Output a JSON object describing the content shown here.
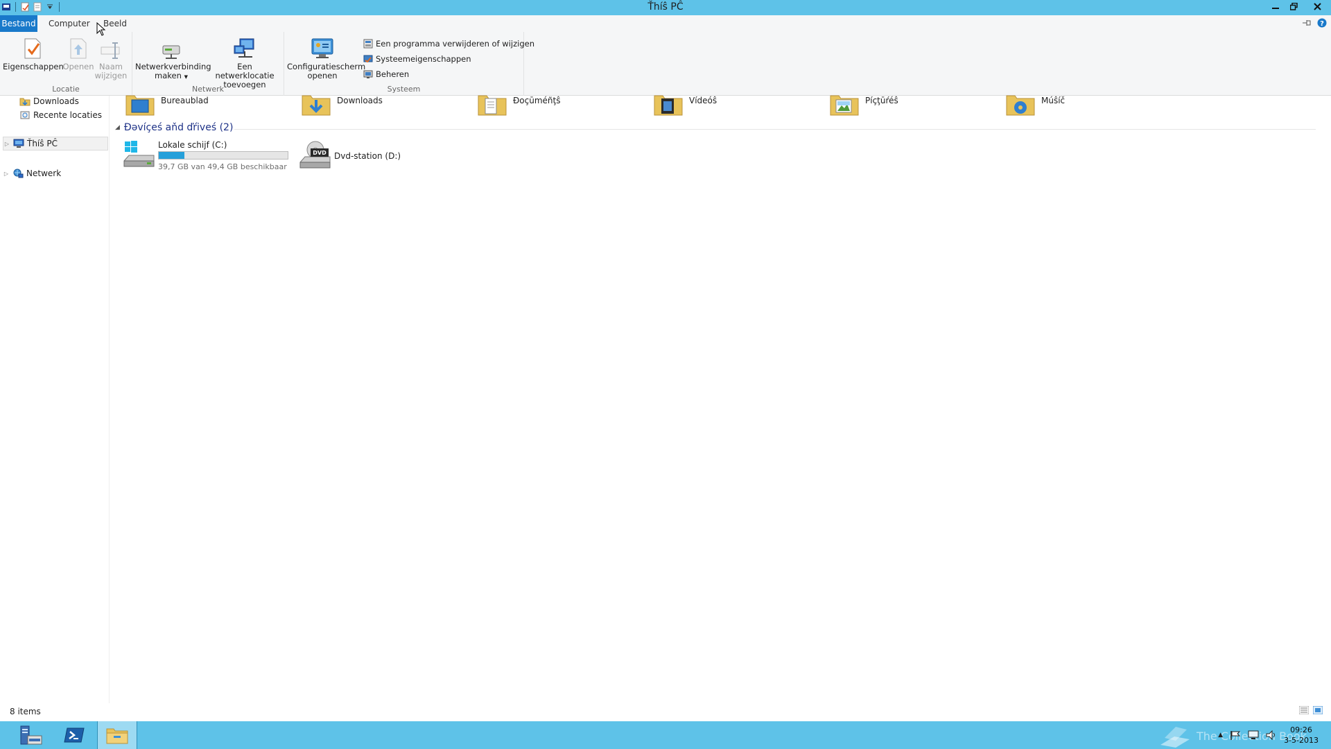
{
  "window": {
    "title": "Ťhíŝ PĈ"
  },
  "tabs": {
    "file": "Bestand",
    "computer": "Computer",
    "view": "Beeld"
  },
  "ribbon": {
    "groups": {
      "location": "Locatie",
      "network": "Netwerk",
      "system": "Systeem"
    },
    "properties": "Eigenschappen",
    "open": "Openen",
    "rename_line1": "Naam",
    "rename_line2": "wijzigen",
    "map_drive_line1": "Netwerkverbinding",
    "map_drive_line2": "maken",
    "add_netloc_line1": "Een netwerklocatie",
    "add_netloc_line2": "toevoegen",
    "control_panel_line1": "Configuratiescherm",
    "control_panel_line2": "openen",
    "uninstall": "Een programma verwijderen of wijzigen",
    "system_properties": "Systeemeigenschappen",
    "manage": "Beheren"
  },
  "nav": {
    "downloads": "Downloads",
    "recent": "Recente locaties",
    "this_pc": "Ťhíŝ PĈ",
    "network": "Netwerk"
  },
  "folders": [
    {
      "name": "Bureaublad"
    },
    {
      "name": "Downloads"
    },
    {
      "name": "Đoçūméñţŝ"
    },
    {
      "name": "Vídeóŝ"
    },
    {
      "name": "Píçţūŕéŝ"
    },
    {
      "name": "Múŝíč"
    }
  ],
  "devices": {
    "header": "Ðəvíçeś aňd ďŕiveś (2)",
    "drive_c": {
      "name": "Lokale schijf (C:)",
      "free": "39,7 GB van 49,4 GB beschikbaar",
      "used_fraction": 0.2
    },
    "drive_d": {
      "name": "Dvd-station (D:)",
      "badge": "DVD"
    }
  },
  "status": {
    "items": "8 items"
  },
  "taskbar": {
    "time": "09:26",
    "date": "3-5-2013",
    "watermark": "The Collection Book"
  }
}
